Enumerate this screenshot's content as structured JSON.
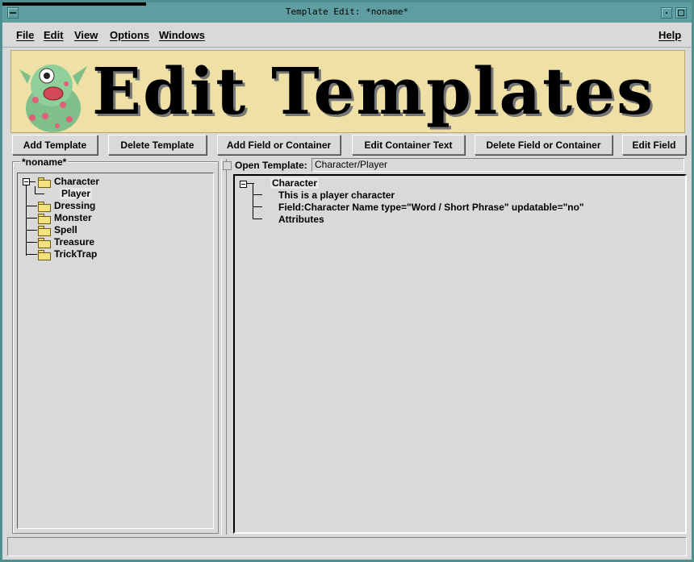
{
  "window": {
    "title": "Template Edit: *noname*"
  },
  "menus": {
    "file": "File",
    "edit": "Edit",
    "view": "View",
    "options": "Options",
    "windows": "Windows",
    "help": "Help"
  },
  "banner": {
    "title": "Edit Templates"
  },
  "toolbar": {
    "add_template": "Add Template",
    "delete_template": "Delete Template",
    "add_field_or_container": "Add Field or Container",
    "edit_container_text": "Edit Container Text",
    "delete_field_or_container": "Delete Field or Container",
    "edit_field": "Edit Field"
  },
  "left_panel": {
    "label": "*noname*",
    "tree": {
      "character": "Character",
      "player": "Player",
      "dressing": "Dressing",
      "monster": "Monster",
      "spell": "Spell",
      "treasure": "Treasure",
      "tricktrap": "TrickTrap"
    }
  },
  "right_panel": {
    "open_label": "Open Template:",
    "open_value": "Character/Player",
    "tree": {
      "root": "Character",
      "description": "This is a player character",
      "field": "Field:Character Name type=\"Word / Short Phrase\" updatable=\"no\"",
      "attributes": "Attributes"
    }
  },
  "colors": {
    "titlebar": "#5f9ea0",
    "banner_bg": "#efe0a6",
    "panel_bg": "#d9d9d9"
  }
}
